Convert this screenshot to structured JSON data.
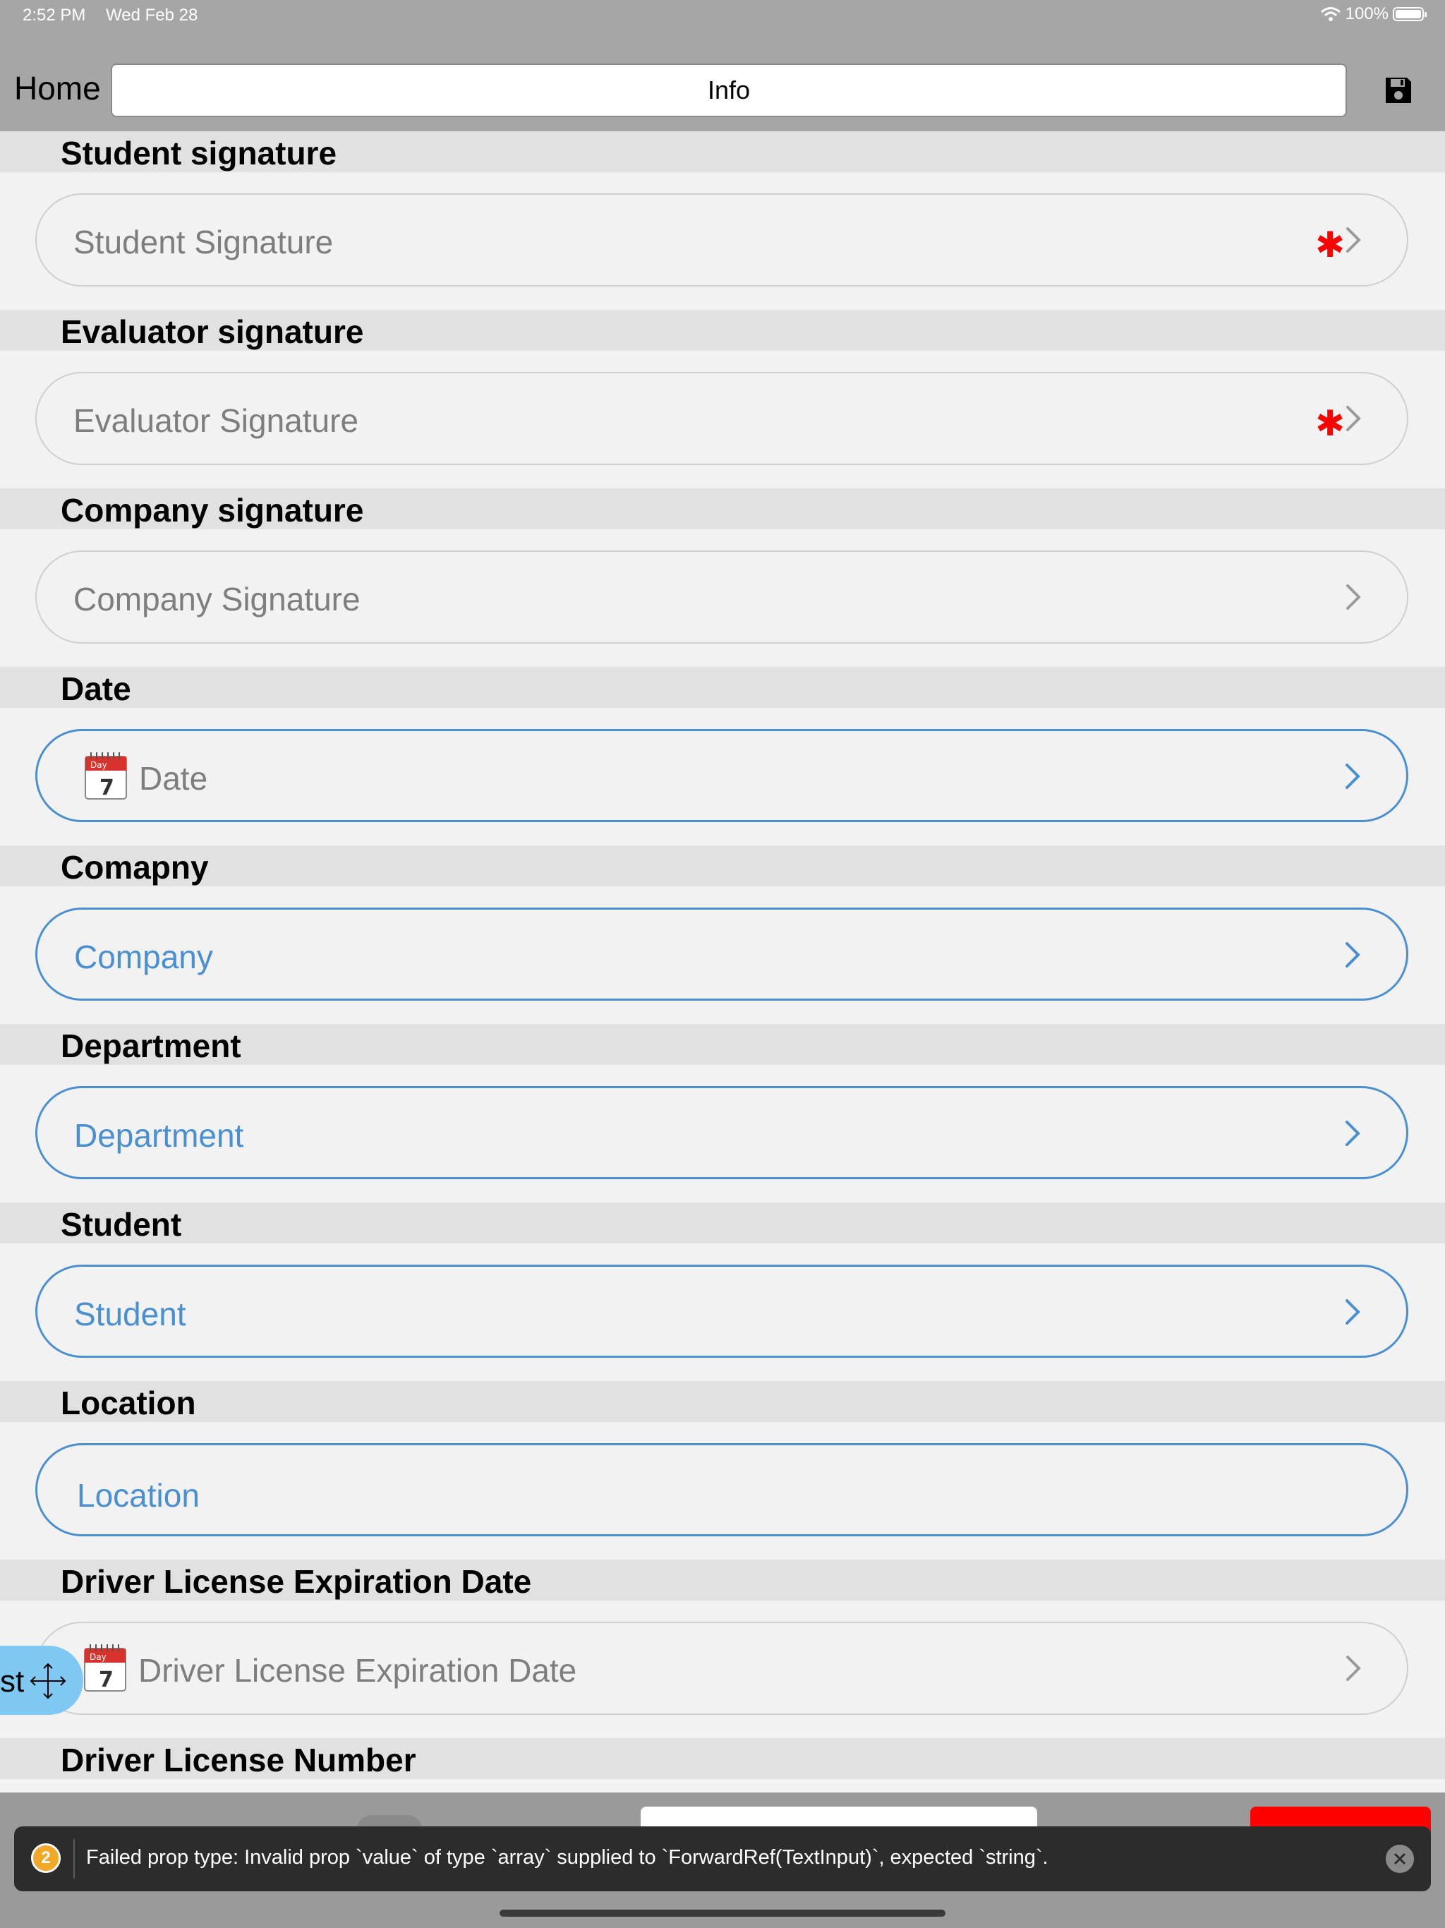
{
  "status": {
    "time": "2:52 PM",
    "date": "Wed Feb 28",
    "battery": "100%"
  },
  "nav": {
    "back_label": "Home",
    "title": "Info",
    "save_icon": "floppy-disk-icon"
  },
  "sections": [
    {
      "header": "Student signature",
      "field": "Student Signature",
      "required": true
    },
    {
      "header": "Evaluator signature",
      "field": "Evaluator Signature",
      "required": true
    },
    {
      "header": "Company signature",
      "field": "Company Signature",
      "required": false
    },
    {
      "header": "Date",
      "field": "Date",
      "icon": "calendar-icon",
      "icon_month": "Day",
      "icon_day": "7"
    },
    {
      "header": "Comapny",
      "field": "Company"
    },
    {
      "header": "Department",
      "field": "Department"
    },
    {
      "header": "Student",
      "field": "Student"
    },
    {
      "header": "Location",
      "field": "Location"
    },
    {
      "header": "Driver License Expiration Date",
      "field": "Driver License Expiration Date",
      "icon": "calendar-icon",
      "icon_month": "Day",
      "icon_day": "7"
    },
    {
      "header": "Driver License Number"
    }
  ],
  "floating_tab": {
    "label": "st"
  },
  "required_marker": "✱",
  "error": {
    "count": "2",
    "message": "Failed prop type: Invalid prop `value` of type `array` supplied to `ForwardRef(TextInput)`, expected `string`."
  },
  "colors": {
    "accent": "#4a8fd0",
    "required": "#ff0000",
    "header_bg": "#e1e1e1",
    "bar_bg": "#a6a6a6"
  }
}
